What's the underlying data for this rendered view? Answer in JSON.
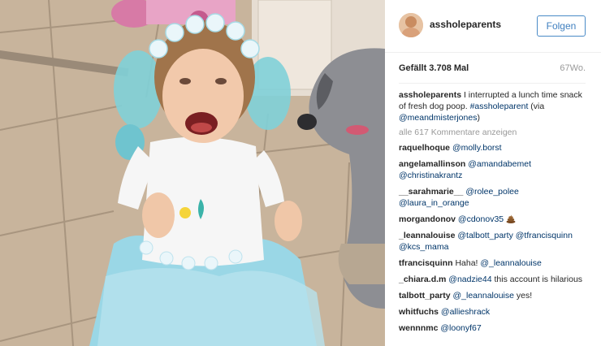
{
  "post": {
    "username": "assholeparents",
    "follow_label": "Folgen",
    "likes": "Gefällt 3.708 Mal",
    "age": "67Wo.",
    "caption": {
      "user": "assholeparents",
      "text1": " I interrupted a lunch time snack of fresh dog poop. ",
      "hashtag": "#assholeparent",
      "text2": " (via ",
      "mention": "@meandmisterjones",
      "text3": ")"
    },
    "load_more": "alle 617 Kommentare anzeigen"
  },
  "comments": [
    {
      "user": "raquelhoque",
      "parts": [
        {
          "t": "@molly.borst",
          "link": true
        }
      ]
    },
    {
      "user": "angelamallinson",
      "parts": [
        {
          "t": "@amandabemet",
          "link": true
        },
        {
          "t": " ",
          "link": false
        },
        {
          "t": "@christinakrantz",
          "link": true
        }
      ]
    },
    {
      "user": "__sarahmarie__",
      "parts": [
        {
          "t": "@rolee_polee",
          "link": true
        },
        {
          "t": " ",
          "link": false
        },
        {
          "t": "@laura_in_orange",
          "link": true
        }
      ]
    },
    {
      "user": "morgandonov",
      "parts": [
        {
          "t": "@cdonov35",
          "link": true
        }
      ],
      "emoji": "poop-emoji"
    },
    {
      "user": "_leannalouise",
      "parts": [
        {
          "t": "@talbott_party",
          "link": true
        },
        {
          "t": " ",
          "link": false
        },
        {
          "t": "@tfrancisquinn",
          "link": true
        },
        {
          "t": " ",
          "link": false
        },
        {
          "t": "@kcs_mama",
          "link": true
        }
      ]
    },
    {
      "user": "tfrancisquinn",
      "parts": [
        {
          "t": "Haha! ",
          "link": false
        },
        {
          "t": "@_leannalouise",
          "link": true
        }
      ]
    },
    {
      "user": "_chiara.d.m",
      "parts": [
        {
          "t": "@nadzie44",
          "link": true
        },
        {
          "t": " this account is hilarious",
          "link": false
        }
      ]
    },
    {
      "user": "talbott_party",
      "parts": [
        {
          "t": "@_leannalouise",
          "link": true
        },
        {
          "t": " yes!",
          "link": false
        }
      ]
    },
    {
      "user": "whitfuchs",
      "parts": [
        {
          "t": "@allieshrack",
          "link": true
        }
      ]
    },
    {
      "user": "wennnmc",
      "parts": [
        {
          "t": "@loonyf67",
          "link": true
        }
      ]
    }
  ],
  "colors": {
    "link": "#003569",
    "follow": "#3f7fbf",
    "muted": "#999999",
    "text": "#262626"
  },
  "icons": {
    "avatar": "avatar",
    "poop": "poop-emoji"
  }
}
